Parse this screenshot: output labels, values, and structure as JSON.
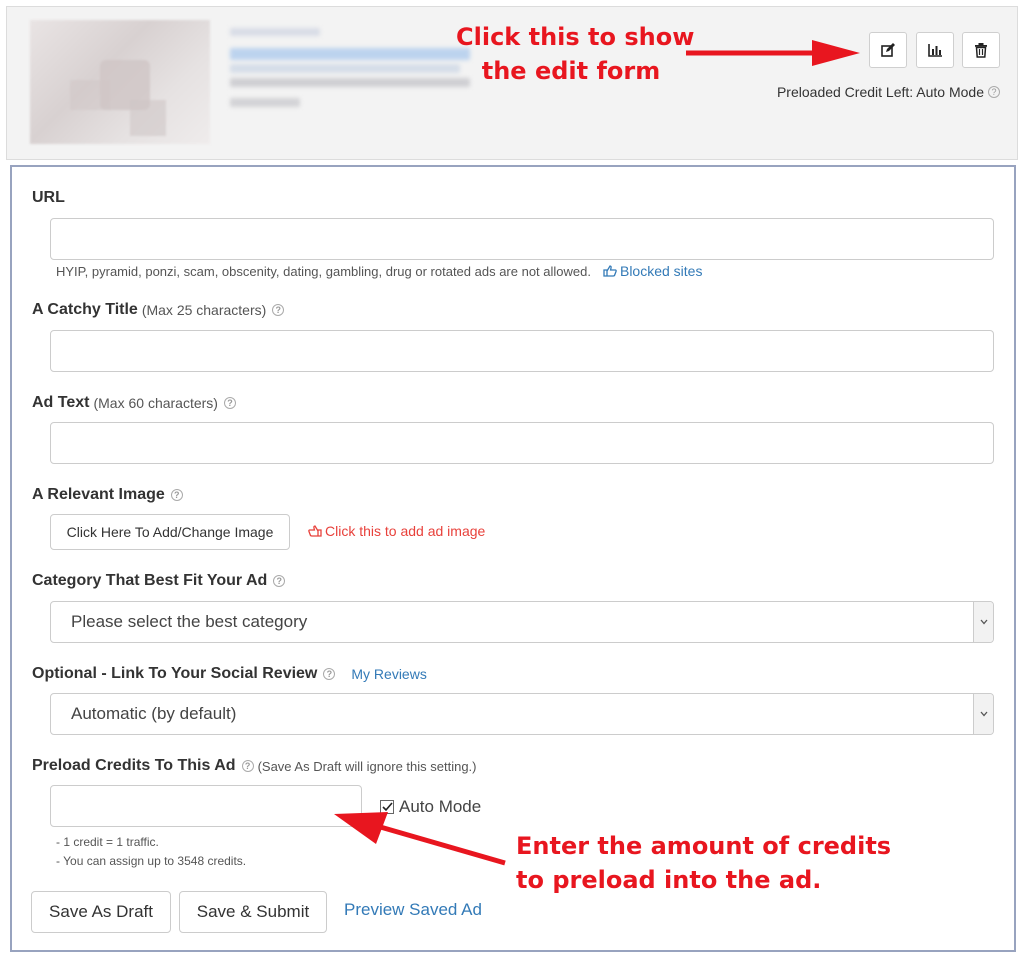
{
  "header": {
    "annotation_line1": "Click this to show",
    "annotation_line2": "the edit form",
    "buttons": [
      {
        "name": "edit-button",
        "icon": "edit-icon"
      },
      {
        "name": "stats-button",
        "icon": "bar-chart-icon"
      },
      {
        "name": "delete-button",
        "icon": "trash-icon"
      }
    ],
    "credit_label": "Preloaded Credit Left: Auto Mode"
  },
  "form": {
    "url": {
      "label": "URL",
      "value": "",
      "hint": "HYIP, pyramid, ponzi, scam, obscenity, dating, gambling, drug or rotated ads are not allowed.",
      "blocked_link": "Blocked sites"
    },
    "title": {
      "label": "A Catchy Title",
      "sub": "(Max 25 characters)",
      "value": ""
    },
    "ad_text": {
      "label": "Ad Text",
      "sub": "(Max 60 characters)",
      "value": ""
    },
    "image": {
      "label": "A Relevant Image",
      "button": "Click Here To Add/Change Image",
      "note": "Click this to add ad image"
    },
    "category": {
      "label": "Category That Best Fit Your Ad",
      "selected": "Please select the best category"
    },
    "review": {
      "label": "Optional - Link To Your Social Review",
      "link": "My Reviews",
      "selected": "Automatic (by default)"
    },
    "preload": {
      "label": "Preload Credits To This Ad",
      "sub": "(Save As Draft will ignore this setting.)",
      "value": "",
      "auto_mode_label": "Auto Mode",
      "auto_mode_checked": true,
      "hint1": "- 1 credit = 1 traffic.",
      "hint2": "- You can assign up to 3548 credits."
    },
    "actions": {
      "save_draft": "Save As Draft",
      "save_submit": "Save & Submit",
      "preview": "Preview Saved Ad"
    },
    "annotation_line1": "Enter the amount  of credits",
    "annotation_line2": "to preload into the ad."
  },
  "colors": {
    "annotation": "#e8161f",
    "link": "#337ab7",
    "panel_border": "#98a3bf",
    "note_red": "#e8413b"
  }
}
